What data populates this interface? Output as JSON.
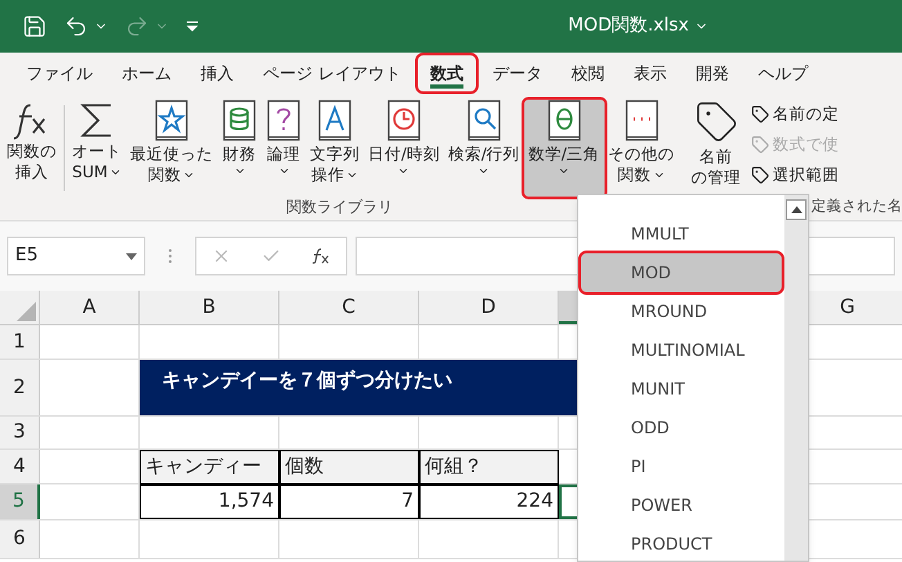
{
  "title_bar": {
    "file_name": "MOD関数.xlsx"
  },
  "tabs": [
    {
      "label": "ファイル",
      "selected": false,
      "annotated": false
    },
    {
      "label": "ホーム",
      "selected": false,
      "annotated": false
    },
    {
      "label": "挿入",
      "selected": false,
      "annotated": false
    },
    {
      "label": "ページ レイアウト",
      "selected": false,
      "annotated": false
    },
    {
      "label": "数式",
      "selected": true,
      "annotated": true
    },
    {
      "label": "データ",
      "selected": false,
      "annotated": false
    },
    {
      "label": "校閲",
      "selected": false,
      "annotated": false
    },
    {
      "label": "表示",
      "selected": false,
      "annotated": false
    },
    {
      "label": "開発",
      "selected": false,
      "annotated": false
    },
    {
      "label": "ヘルプ",
      "selected": false,
      "annotated": false
    }
  ],
  "ribbon": {
    "group_label": "関数ライブラリ",
    "buttons": [
      {
        "kind": "fx",
        "lines": [
          "関数の",
          "挿入"
        ],
        "dropdown": false,
        "selected": false,
        "annotated": false
      },
      {
        "kind": "sum",
        "lines": [
          "オート",
          "SUM"
        ],
        "dropdown": true,
        "selected": false,
        "annotated": false
      },
      {
        "kind": "star",
        "lines": [
          "最近使った",
          "関数"
        ],
        "dropdown": true,
        "selected": false,
        "annotated": false
      },
      {
        "kind": "database",
        "lines": [
          "財務"
        ],
        "dropdown": true,
        "selected": false,
        "annotated": false
      },
      {
        "kind": "question",
        "lines": [
          "論理"
        ],
        "dropdown": true,
        "selected": false,
        "annotated": false
      },
      {
        "kind": "letter",
        "lines": [
          "文字列",
          "操作"
        ],
        "dropdown": true,
        "selected": false,
        "annotated": false
      },
      {
        "kind": "clock",
        "lines": [
          "日付/時刻"
        ],
        "dropdown": true,
        "selected": false,
        "annotated": false
      },
      {
        "kind": "search",
        "lines": [
          "検索/行列"
        ],
        "dropdown": true,
        "selected": false,
        "annotated": false
      },
      {
        "kind": "theta",
        "lines": [
          "数学/三角"
        ],
        "dropdown": true,
        "selected": true,
        "annotated": true
      },
      {
        "kind": "dots",
        "lines": [
          "その他の",
          "関数"
        ],
        "dropdown": true,
        "selected": false,
        "annotated": false
      }
    ],
    "names_group": {
      "manage_lines": [
        "名前",
        "の管理"
      ],
      "group_label": "定義された名",
      "items": [
        {
          "label": "名前の定",
          "disabled": false
        },
        {
          "label": "数式で使",
          "disabled": true
        },
        {
          "label": "選択範囲",
          "disabled": false
        }
      ]
    }
  },
  "formula_bar": {
    "name_box": "E5"
  },
  "sheet": {
    "columns": [
      {
        "label": "A",
        "selected": false
      },
      {
        "label": "B",
        "selected": false
      },
      {
        "label": "C",
        "selected": false
      },
      {
        "label": "D",
        "selected": false
      },
      {
        "selected": true
      },
      {
        "label": "G",
        "selected": false
      }
    ],
    "rows": [
      {
        "label": "1",
        "selected": false
      },
      {
        "label": "2",
        "selected": false
      },
      {
        "label": "3",
        "selected": false
      },
      {
        "label": "4",
        "selected": false
      },
      {
        "label": "5",
        "selected": true
      },
      {
        "label": "6",
        "selected": false
      }
    ],
    "title": "キャンデイーを７個ずつ分けたい",
    "headers": [
      "キャンディー",
      "個数",
      "何組？"
    ],
    "values": [
      "1,574",
      "7",
      "224"
    ]
  },
  "dropdown": {
    "items": [
      {
        "label": "MMULT",
        "selected": false
      },
      {
        "label": "MOD",
        "selected": true
      },
      {
        "label": "MROUND",
        "selected": false
      },
      {
        "label": "MULTINOMIAL",
        "selected": false
      },
      {
        "label": "MUNIT",
        "selected": false
      },
      {
        "label": "ODD",
        "selected": false
      },
      {
        "label": "PI",
        "selected": false
      },
      {
        "label": "POWER",
        "selected": false
      },
      {
        "label": "PRODUCT",
        "selected": false
      }
    ]
  }
}
